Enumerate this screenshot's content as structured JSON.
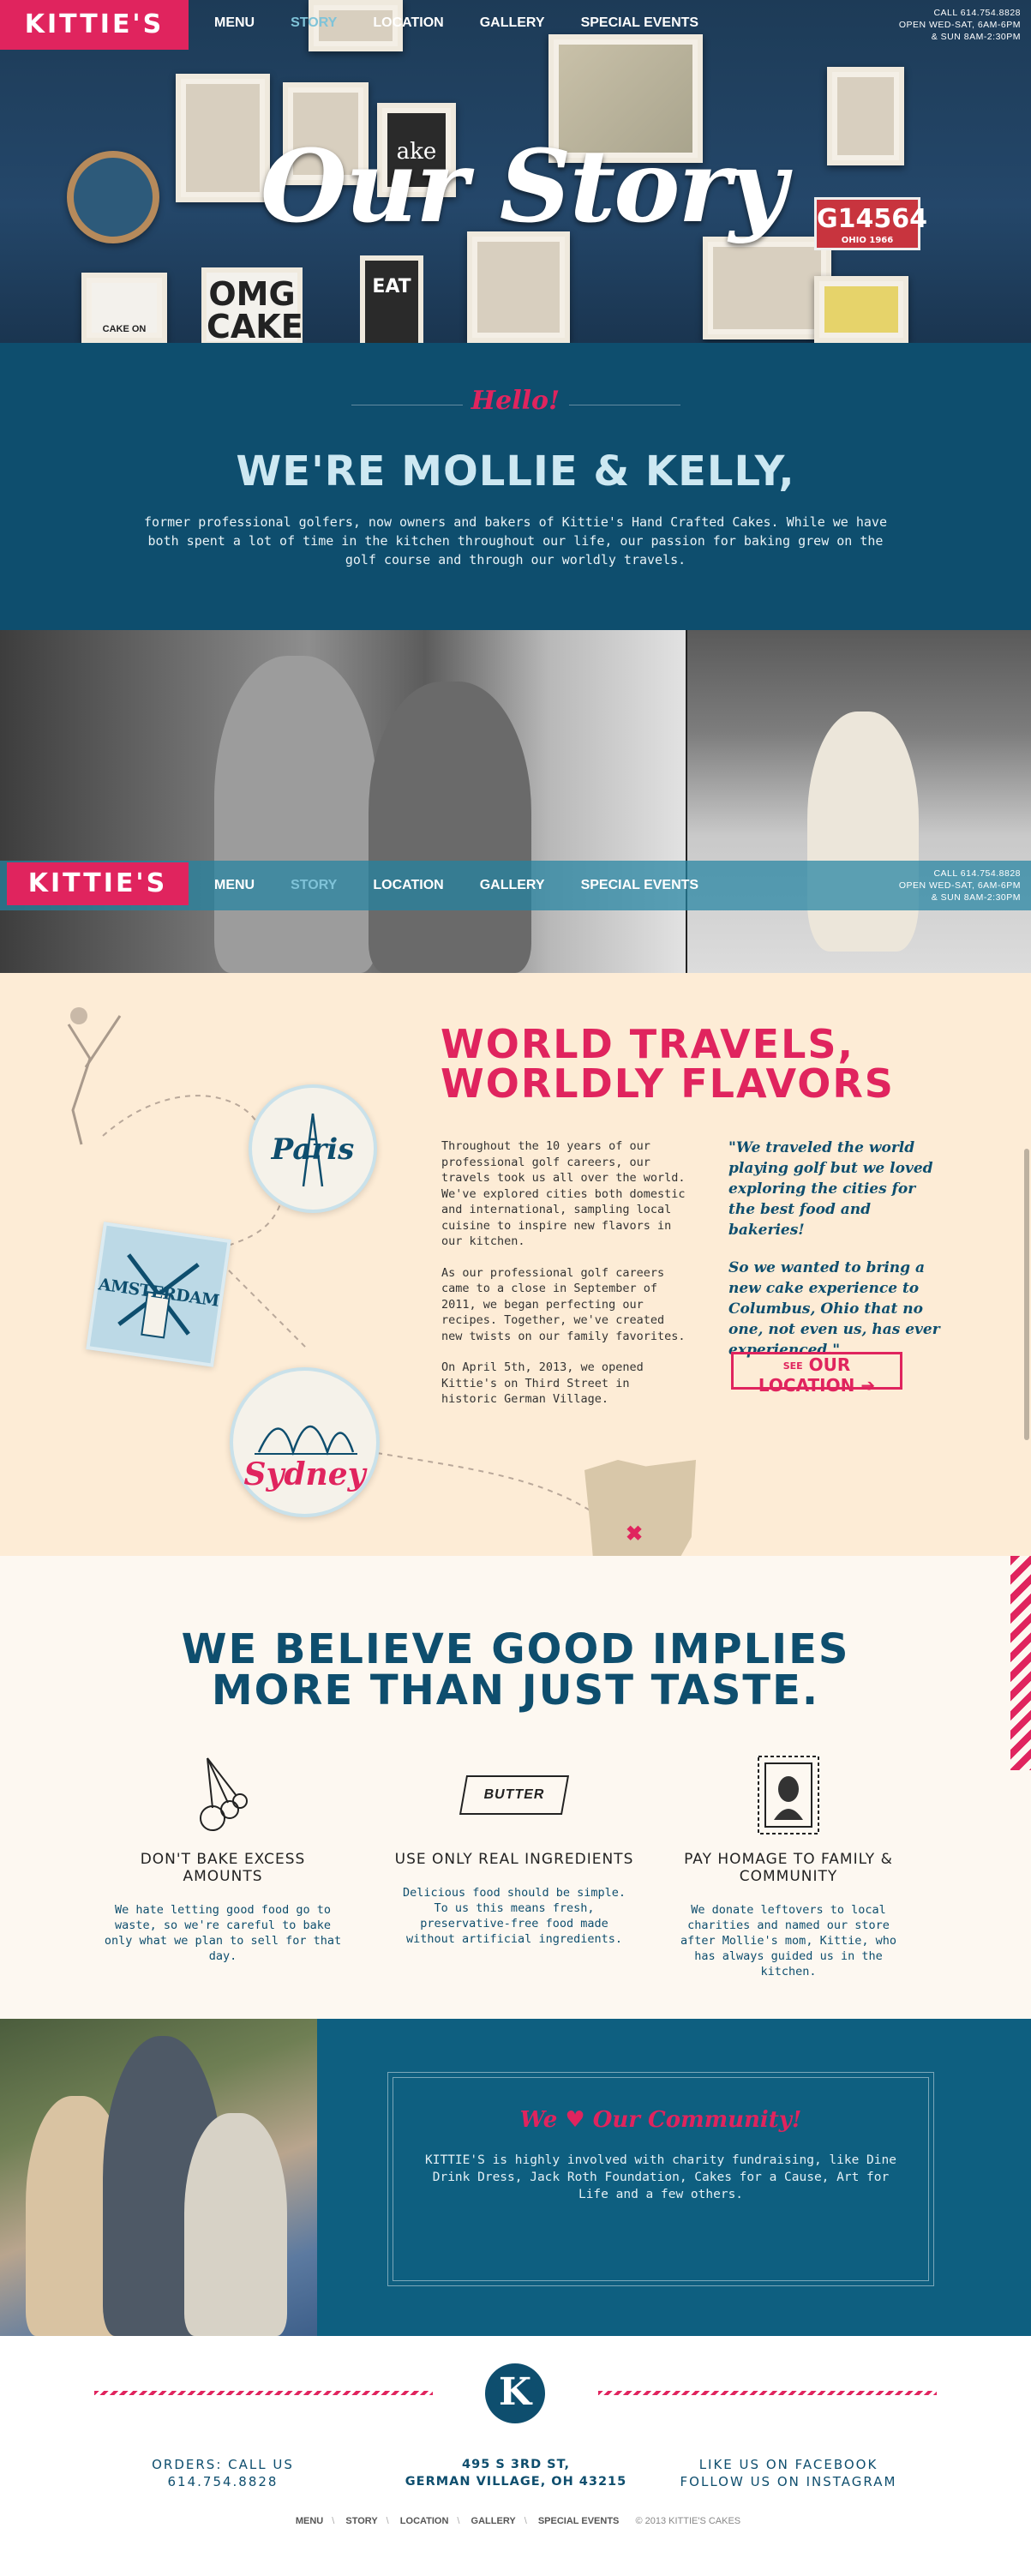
{
  "brand": {
    "logo": "KITTIE'S",
    "pink": "#e0245e",
    "navy": "#0e4e6e",
    "cream": "#fdecd6"
  },
  "nav": {
    "items": [
      "MENU",
      "STORY",
      "LOCATION",
      "GALLERY",
      "SPECIAL EVENTS"
    ],
    "active": "STORY",
    "hours": [
      "CALL 614.754.8828",
      "OPEN WED-SAT, 6AM-6PM",
      "& SUN 8AM-2:30PM"
    ]
  },
  "hero": {
    "title": "Our Story",
    "frames": {
      "omg": "OMG CAKE",
      "eat": "EAT",
      "plate": "G14564",
      "plate_sub": "OHIO 1966",
      "cake_on": "CAKE ON",
      "cake_letters": "ake"
    }
  },
  "hello": {
    "script": "Hello!",
    "heading": "WE'RE MOLLIE & KELLY,",
    "body": "former professional golfers, now owners and bakers of Kittie's Hand Crafted Cakes. While we have both spent a lot of time in the kitchen throughout our life, our passion for baking grew on the golf course and through our worldly travels."
  },
  "travels": {
    "heading_line1": "WORLD TRAVELS,",
    "heading_line2": "WORLDLY FLAVORS",
    "para1": "Throughout the 10 years of our professional golf careers, our travels took us all over the world. We've explored cities both domestic and international, sampling local cuisine to inspire new flavors in our kitchen.",
    "para2": "As our professional golf careers came to a close in September of 2011, we began perfecting our recipes. Together, we've created new twists on our family favorites.",
    "para3": "On April 5th, 2013, we opened Kittie's on Third Street in historic German Village.",
    "quote1": "\"We traveled the world playing golf but we loved exploring the cities for the best food and bakeries!",
    "quote2": "So we wanted to bring a new cake experience to Columbus, Ohio that no one, not even us, has ever experienced.\"",
    "button_prefix": "SEE",
    "button": "OUR LOCATION",
    "cities": [
      "Paris",
      "AMSTERDAM",
      "Sydney"
    ]
  },
  "believe": {
    "heading_line1": "WE BELIEVE GOOD IMPLIES",
    "heading_line2": "MORE THAN JUST TASTE.",
    "butter_label": "BUTTER",
    "values": [
      {
        "title": "DON'T BAKE EXCESS AMOUNTS",
        "icon": "measuring-spoons-icon",
        "text": "We hate letting good food go to waste, so we're careful to bake only what we plan to sell for that day."
      },
      {
        "title": "USE ONLY REAL INGREDIENTS",
        "icon": "butter-icon",
        "text": "Delicious food should be simple. To us this means fresh, preservative-free food made without artificial ingredients."
      },
      {
        "title": "PAY HOMAGE TO FAMILY & COMMUNITY",
        "icon": "cameo-stamp-icon",
        "text": "We donate leftovers to local charities and named our store after Mollie's mom, Kittie, who has always guided us in the kitchen."
      }
    ]
  },
  "community": {
    "script_we": "We",
    "script_rest": "Our Community!",
    "body": "KITTIE'S is highly involved with charity fundraising, like Dine Drink Dress, Jack Roth Foundation, Cakes for a Cause, Art for Life and a few others."
  },
  "footer": {
    "badge": "K",
    "orders_line1": "ORDERS: CALL US",
    "orders_line2": "614.754.8828",
    "address_line1": "495 S 3RD ST,",
    "address_line2": "GERMAN VILLAGE, OH 43215",
    "social_line1": "LIKE US ON FACEBOOK",
    "social_line2": "FOLLOW US ON INSTAGRAM",
    "links": [
      "MENU",
      "STORY",
      "LOCATION",
      "GALLERY",
      "SPECIAL EVENTS"
    ],
    "copyright": "© 2013 KITTIE'S CAKES"
  }
}
